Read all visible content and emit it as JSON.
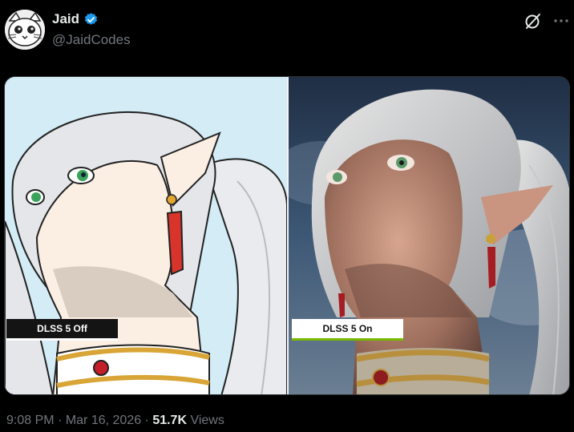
{
  "header": {
    "display_name": "Jaid",
    "handle": "@JaidCodes"
  },
  "icons": {
    "avatar": "avatar-cat",
    "verified": "verified-badge-icon",
    "grok": "grok-icon",
    "more": "more-options-icon"
  },
  "media": {
    "left_label": "DLSS 5 Off",
    "right_label": "DLSS 5 On"
  },
  "meta": {
    "time": "9:08 PM",
    "separator1": " · ",
    "date": "Mar 16, 2026",
    "separator2": " · ",
    "views_count": "51.7K",
    "views_label": " Views"
  },
  "colors": {
    "background": "#000000",
    "verified": "#1d9bf0",
    "nvidia_green": "#76b900",
    "muted": "#71767b"
  }
}
